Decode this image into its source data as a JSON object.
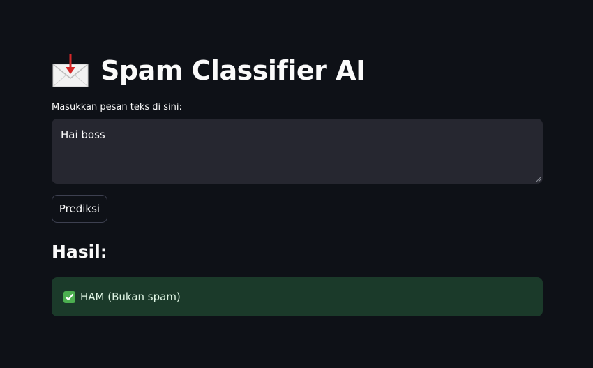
{
  "app": {
    "title": "Spam Classifier AI",
    "title_icon": "envelope-with-arrow-icon"
  },
  "form": {
    "input_label": "Masukkan pesan teks di sini:",
    "input_value": "Hai boss",
    "submit_label": "Prediksi"
  },
  "result": {
    "heading": "Hasil:",
    "status_icon": "check-mark-icon",
    "status_text": "HAM (Bukan spam)"
  },
  "colors": {
    "background": "#0e1117",
    "input_background": "#262730",
    "success_background": "#1b3a2a",
    "success_icon": "#4caf50",
    "arrow_red": "#d62828"
  }
}
